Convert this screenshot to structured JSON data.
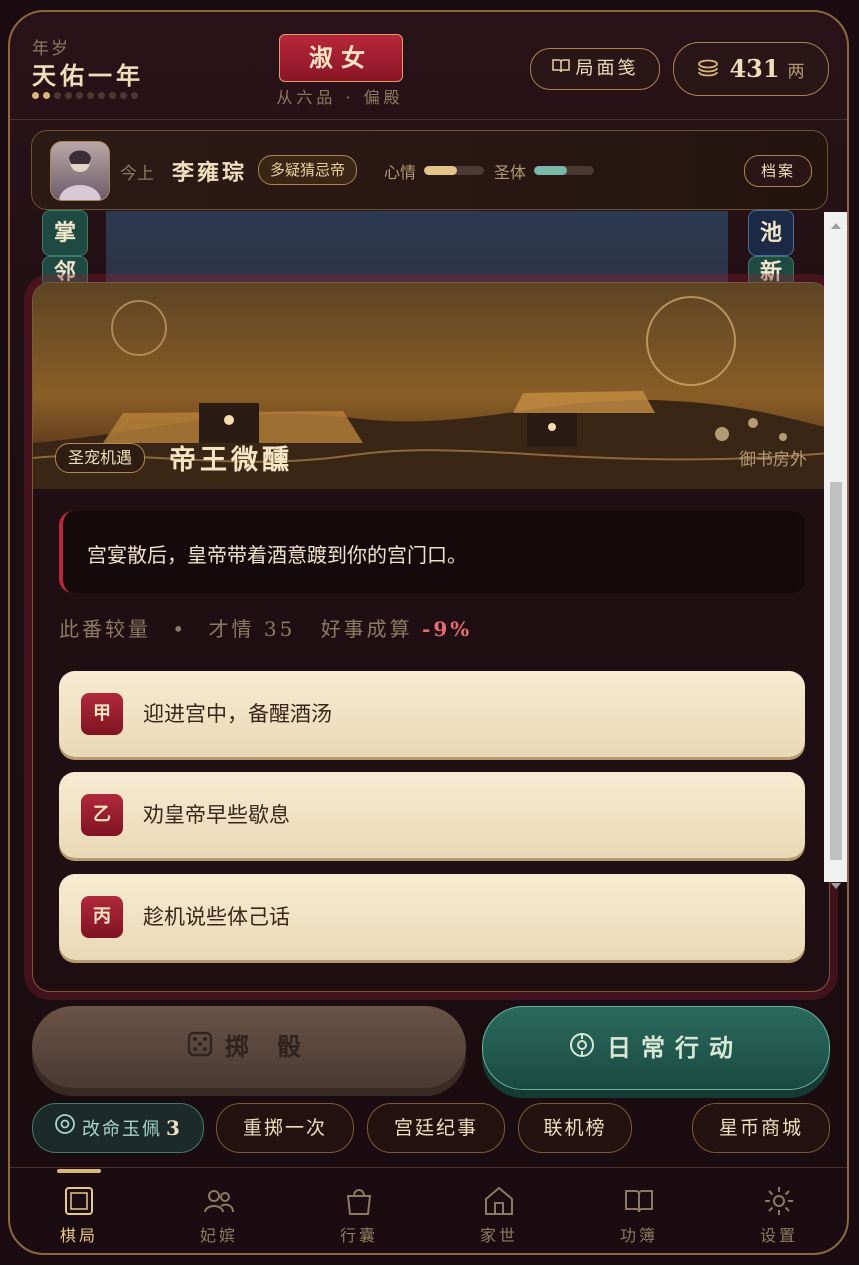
{
  "header": {
    "year_label": "年岁",
    "year_name": "天佑一年",
    "rank": "淑女",
    "rank_sub": "从六品 · 偏殿",
    "book_label": "局面笺",
    "coins": "431",
    "coin_unit": "两"
  },
  "emperor": {
    "title": "今上",
    "name": "李雍琮",
    "trait": "多疑猜忌帝",
    "mood_label": "心情",
    "mood_level": 0.55,
    "body_label": "圣体",
    "body_level": 0.55,
    "dossier_label": "档案"
  },
  "board_tiles": {
    "left_top": "掌",
    "left_bottom": "邻",
    "right_top": "池",
    "right_bottom": "新"
  },
  "event": {
    "tag": "圣宠机遇",
    "title": "帝王微醺",
    "place": "御书房外",
    "description": "宫宴散后，皇帝带着酒意踱到你的宫门口。",
    "compare_label": "此番较量",
    "stat_label": "才情",
    "stat_value": "35",
    "odds_label": "好事成算",
    "odds_value": "-9%",
    "options": [
      {
        "badge": "甲",
        "text": "迎进宫中，备醒酒汤"
      },
      {
        "badge": "乙",
        "text": "劝皇帝早些歇息"
      },
      {
        "badge": "丙",
        "text": "趁机说些体己话"
      }
    ]
  },
  "actions": {
    "roll": "掷 骰",
    "daily": "日常行动"
  },
  "chips": {
    "jade_label": "改命玉佩",
    "jade_count": "3",
    "reroll": "重掷一次",
    "chronicle": "宫廷纪事",
    "leaderboard": "联机榜",
    "shop": "星币商城"
  },
  "nav": [
    {
      "label": "棋局",
      "icon": "board-icon",
      "active": true
    },
    {
      "label": "妃嫔",
      "icon": "people-icon"
    },
    {
      "label": "行囊",
      "icon": "bag-icon"
    },
    {
      "label": "家世",
      "icon": "house-icon"
    },
    {
      "label": "功簿",
      "icon": "book-icon"
    },
    {
      "label": "设置",
      "icon": "gear-icon"
    }
  ],
  "colors": {
    "accent_red": "#b8283a",
    "gold": "#d8b877",
    "jade": "#2c6a5e",
    "cream": "#f7ebd2"
  }
}
